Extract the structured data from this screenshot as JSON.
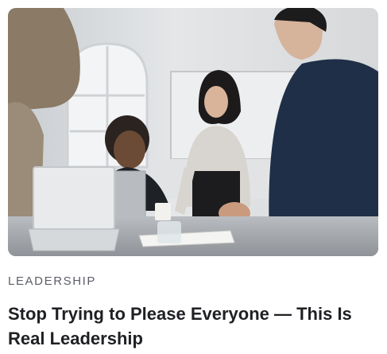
{
  "article": {
    "category": "LEADERSHIP",
    "title": "Stop Trying to Please Everyone — This Is Real Leadership"
  },
  "hero_image": {
    "subject": "team-meeting-photo"
  },
  "colors": {
    "category_text": "#5b5f66",
    "title_text": "#1f2024",
    "background": "#ffffff"
  }
}
